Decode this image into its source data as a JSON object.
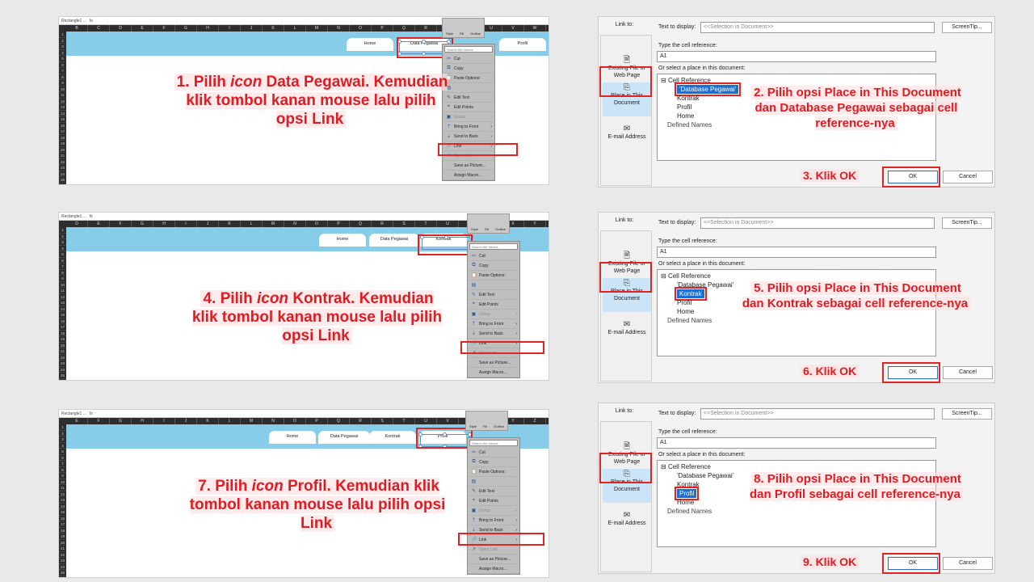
{
  "excel": [
    {
      "namebox": "Rectangle1 ...",
      "fx": "fx",
      "columns": [
        "B",
        "C",
        "D",
        "E",
        "F",
        "G",
        "H",
        "I",
        "J",
        "K",
        "L",
        "M",
        "N",
        "O",
        "P",
        "Q",
        "R",
        "S",
        "T",
        "U",
        "V",
        "W",
        "X"
      ],
      "tabs": [
        "Home",
        "Data Pegawai",
        "",
        "Profil"
      ],
      "instruction_prefix": "1. Pilih ",
      "instruction_icon": "icon",
      "instruction_rest": " Data Pegawai. Kemudian klik tombol kanan mouse lalu pilih opsi Link"
    },
    {
      "namebox": "Rectangle1 ...",
      "fx": "fx",
      "columns": [
        "D",
        "E",
        "F",
        "G",
        "H",
        "I",
        "J",
        "K",
        "L",
        "M",
        "N",
        "O",
        "P",
        "Q",
        "R",
        "S",
        "T",
        "U",
        "V",
        "W",
        "X",
        "Y"
      ],
      "tabs": [
        "Home",
        "Data Pegawai",
        "Kontrak",
        ""
      ],
      "instruction_prefix": "4. Pilih ",
      "instruction_icon": "icon",
      "instruction_rest": " Kontrak. Kemudian klik tombol kanan mouse lalu pilih opsi Link"
    },
    {
      "namebox": "Rectangle1 ...",
      "fx": "fx",
      "columns": [
        "E",
        "F",
        "G",
        "H",
        "I",
        "J",
        "K",
        "L",
        "M",
        "N",
        "O",
        "P",
        "Q",
        "R",
        "S",
        "T",
        "U",
        "V",
        "W",
        "X",
        "Y",
        "Z",
        "AA",
        "AB"
      ],
      "tabs": [
        "Home",
        "Data Pegawai",
        "Kontrak",
        "Profil"
      ],
      "instruction_prefix": "7. Pilih ",
      "instruction_icon": "icon",
      "instruction_rest": " Profil. Kemudian klik tombol kanan mouse lalu pilih opsi Link"
    }
  ],
  "ribbon": {
    "style": "Style",
    "fill": "Fill",
    "outline": "Outline"
  },
  "context_menu": {
    "search": "Search the menus",
    "items": [
      "Cut",
      "Copy",
      "Paste Options:",
      "",
      "Edit Text",
      "Edit Points",
      "Group",
      "Bring to Front",
      "Send to Back",
      "Link",
      "Open Link",
      "Save as Picture...",
      "Assign Macro..."
    ]
  },
  "dialog": {
    "link_to": "Link to:",
    "text_to_display_label": "Text to display:",
    "text_to_display_value": "<<Selection in Document>>",
    "screentip": "ScreenTip...",
    "type_ref_label": "Type the cell reference:",
    "cell_ref": "A1",
    "select_place_label": "Or select a place in this document:",
    "sidebar": [
      "Existing File or Web Page",
      "Place in This Document",
      "E-mail Address"
    ],
    "tree_root": "Cell Reference",
    "tree_items": [
      "'Database Pegawai'",
      "Kontrak",
      "Profil",
      "Home"
    ],
    "defined_names": "Defined Names",
    "ok": "OK",
    "cancel": "Cancel"
  },
  "dialog_steps": [
    {
      "instruction": "2. Pilih opsi Place in This Document dan Database Pegawai sebagai cell reference-nya",
      "ok_label": "3. Klik OK",
      "selected_index": 0
    },
    {
      "instruction": "5. Pilih opsi Place in This Document dan Kontrak sebagai cell reference-nya",
      "ok_label": "6. Klik OK",
      "selected_index": 1
    },
    {
      "instruction": "8. Pilih opsi Place in This Document dan Profil sebagai cell reference-nya",
      "ok_label": "9. Klik OK",
      "selected_index": 2
    }
  ],
  "colors": {
    "accent_red": "#e11b22",
    "banner_blue": "#87cdea",
    "select_blue": "#1a6fd6"
  }
}
